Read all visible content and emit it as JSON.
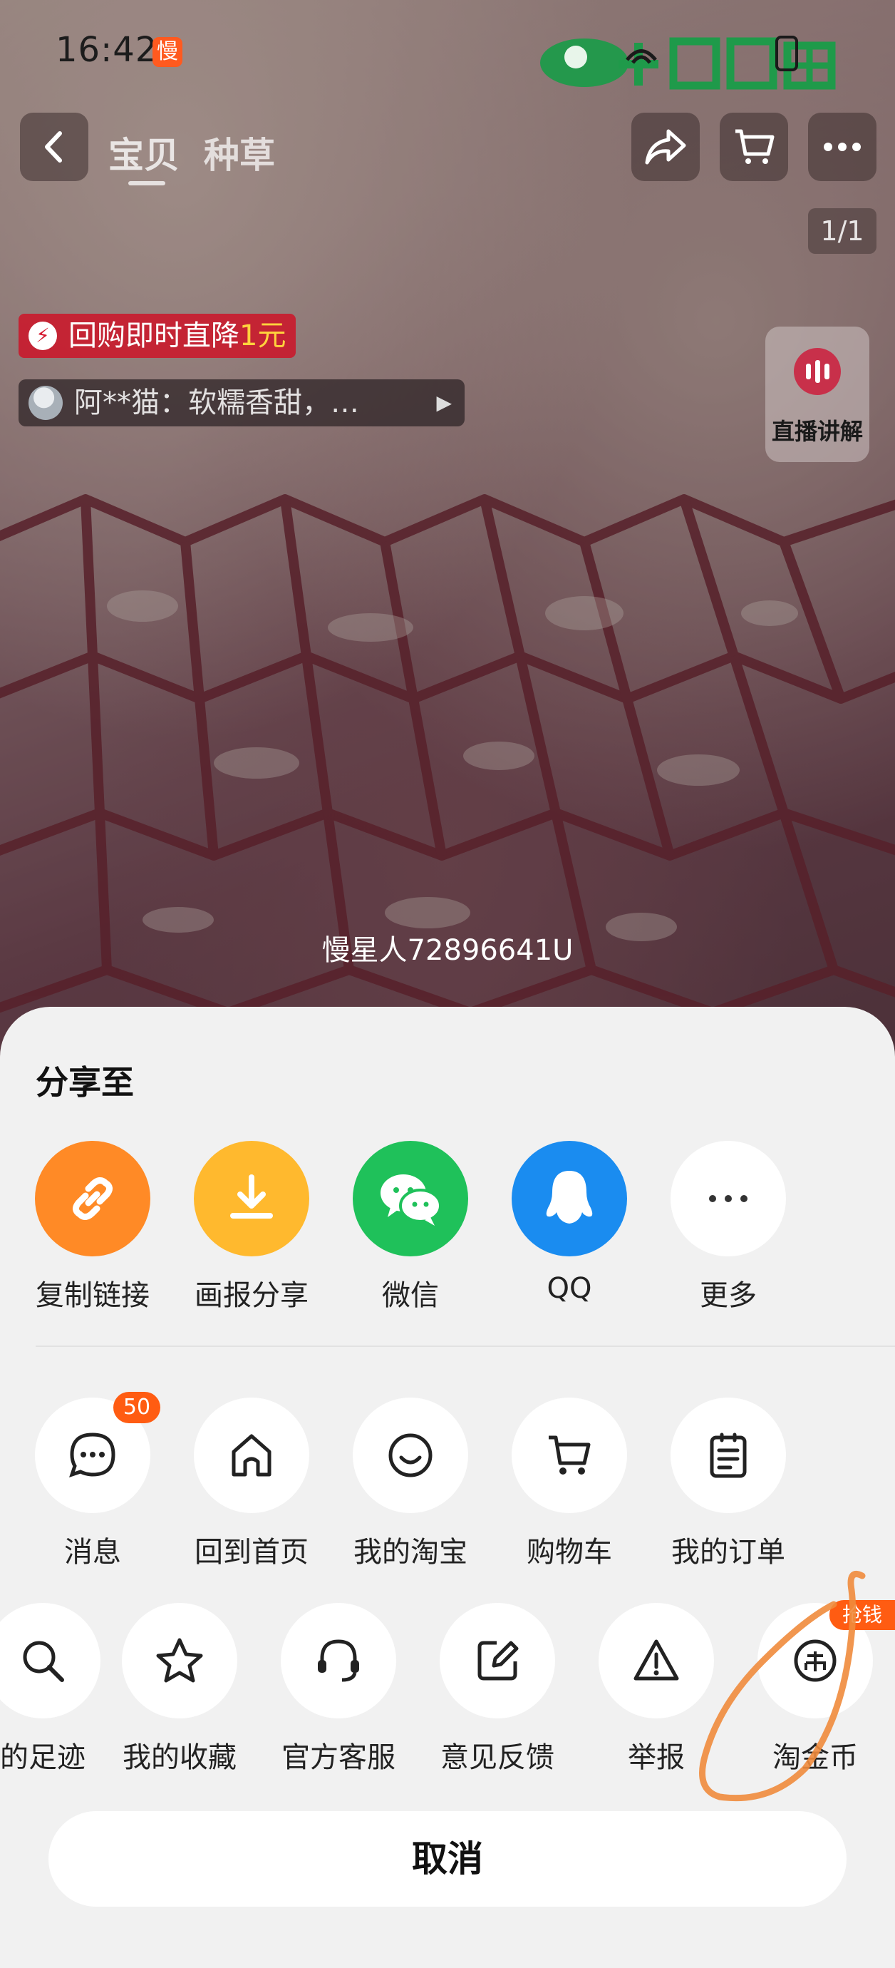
{
  "status_bar": {
    "time": "16:42",
    "slow_badge": "慢"
  },
  "nav": {
    "tabs": [
      "宝贝",
      "种草"
    ],
    "page_counter": "1/1"
  },
  "promo": {
    "text": "回购即时直降",
    "highlight": "1元"
  },
  "review": {
    "text": "阿**猫：软糯香甜，…"
  },
  "live": {
    "label": "直播讲解"
  },
  "watermark": "慢星人72896641U",
  "share_sheet": {
    "title": "分享至",
    "share_row": [
      {
        "label": "复制链接",
        "icon": "link-icon",
        "color": "#ff8a26"
      },
      {
        "label": "画报分享",
        "icon": "download-icon",
        "color": "#ffb92e"
      },
      {
        "label": "微信",
        "icon": "wechat-icon",
        "color": "#1fc15a"
      },
      {
        "label": "QQ",
        "icon": "qq-icon",
        "color": "#1a8cf0"
      },
      {
        "label": "更多",
        "icon": "more-icon",
        "color": "#ffffff"
      }
    ],
    "nav_row": [
      {
        "label": "消息",
        "icon": "message-icon",
        "badge": "50"
      },
      {
        "label": "回到首页",
        "icon": "home-icon"
      },
      {
        "label": "我的淘宝",
        "icon": "smile-icon"
      },
      {
        "label": "购物车",
        "icon": "cart-icon"
      },
      {
        "label": "我的订单",
        "icon": "order-icon"
      }
    ],
    "tools_row": [
      {
        "label": "的足迹",
        "icon": "footprint-icon"
      },
      {
        "label": "我的收藏",
        "icon": "star-icon"
      },
      {
        "label": "官方客服",
        "icon": "headset-icon"
      },
      {
        "label": "意见反馈",
        "icon": "edit-icon"
      },
      {
        "label": "举报",
        "icon": "warning-icon"
      },
      {
        "label": "淘金币",
        "icon": "coin-icon",
        "badge": "抢钱"
      }
    ],
    "cancel_label": "取消"
  }
}
